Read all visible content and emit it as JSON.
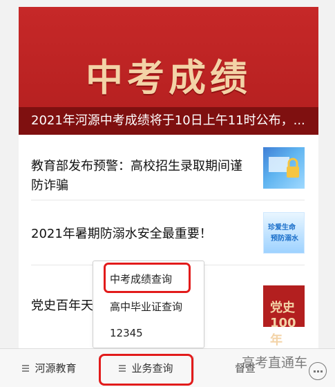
{
  "banner": {
    "title": "中考成绩",
    "caption": "2021年河源中考成绩将于10日上午11时公布，..."
  },
  "articles": [
    {
      "title": "教育部发布预警：高校招生录取期间谨防诈骗",
      "thumb": "anti-fraud-image"
    },
    {
      "title": "2021年暑期防溺水安全最重要！",
      "thumb": "drowning-prevention-image",
      "thumb_text": [
        "珍爱生命",
        "预防溺水"
      ]
    },
    {
      "title": "党史百年天",
      "thumb": "party-history-image",
      "thumb_text": "党史100年"
    }
  ],
  "menu": {
    "items": [
      "中考成绩查询",
      "高中毕业证查询",
      "12345"
    ]
  },
  "tabbar": {
    "tabs": [
      "河源教育",
      "业务查询",
      "督查"
    ],
    "watermark": "高考直通车"
  },
  "colors": {
    "highlight": "#e21b1b",
    "banner": "#b31f1f"
  }
}
